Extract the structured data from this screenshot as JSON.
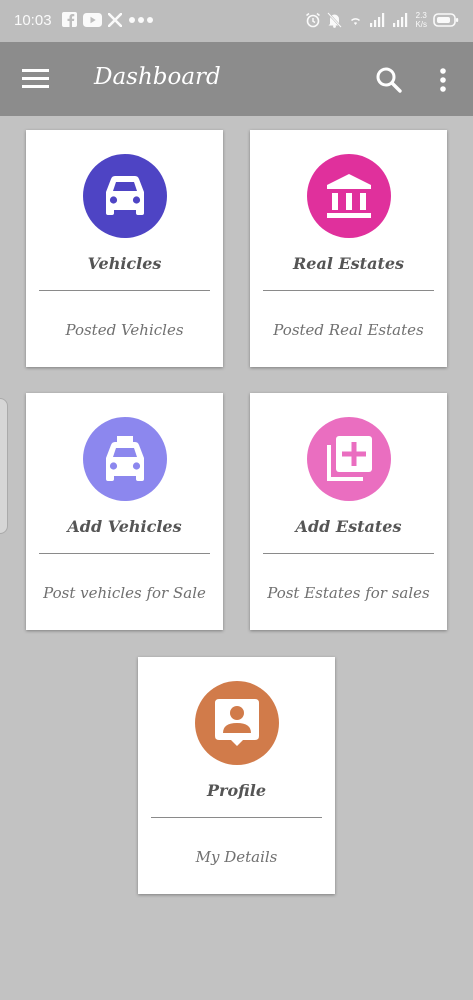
{
  "status_bar": {
    "time": "10:03",
    "network_speed_top": "2.3",
    "network_speed_bottom": "K/s"
  },
  "toolbar": {
    "title": "Dashboard",
    "menu_icon": "hamburger-menu-icon",
    "search_icon": "search-icon",
    "more_icon": "more-vertical-icon"
  },
  "cards": [
    {
      "title": "Vehicles",
      "subtitle": "Posted Vehicles",
      "icon": "car-icon",
      "color": "#4e44c4"
    },
    {
      "title": "Real Estates",
      "subtitle": "Posted Real Estates",
      "icon": "bank-icon",
      "color": "#e0309c"
    },
    {
      "title": "Add Vehicles",
      "subtitle": "Post vehicles for Sale",
      "icon": "taxi-icon",
      "color": "#8c87ee"
    },
    {
      "title": "Add Estates",
      "subtitle": "Post Estates for sales",
      "icon": "library-add-icon",
      "color": "#ea6ec0"
    },
    {
      "title": "Profile",
      "subtitle": "My Details",
      "icon": "contact-icon",
      "color": "#d17b4a"
    }
  ]
}
